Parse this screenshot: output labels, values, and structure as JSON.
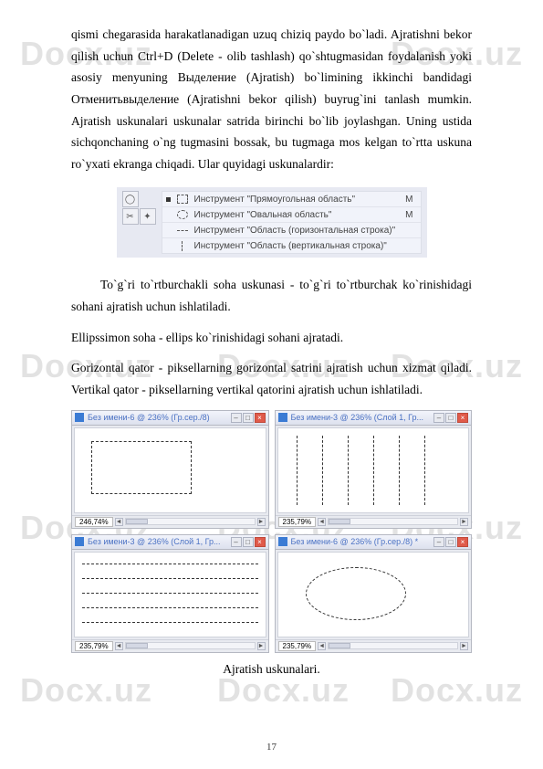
{
  "watermark": "Docx.uz",
  "para1": "qismi chegarasida harakatlanadigan uzuq chiziq paydo bo`ladi. Ajratishni bekor qilish uchun Ctrl+D (Delete - olib tashlash) qo`shtugmasidan foydalanish yoki asosiy menyuning Выделение (Ajratish) bo`limining ikkinchi bandidagi Отменитьвыделение (Ajratishni bekor qilish) buyrug`ini tanlash mumkin. Ajratish uskunalari uskunalar satrida birinchi bo`lib joylashgan. Uning ustida sichqonchaning o`ng tugmasini bossak, bu tugmaga mos kelgan to`rtta uskuna ro`yxati ekranga chiqadi. Ular quyidagi uskunalardir:",
  "toolbox": {
    "items": [
      {
        "label": "Инструмент \"Прямоугольная область\"",
        "key": "M"
      },
      {
        "label": "Инструмент \"Овальная область\"",
        "key": "M"
      },
      {
        "label": "Инструмент \"Область (горизонтальная строка)\"",
        "key": ""
      },
      {
        "label": "Инструмент \"Область (вертикальная строка)\"",
        "key": ""
      }
    ]
  },
  "para2": "To`g`ri to`rtburchakli soha uskunasi - to`g`ri to`rtburchak ko`rinishidagi sohani ajratish uchun ishlatiladi.",
  "para3": "Ellipssimon soha - ellips ko`rinishidagi sohani ajratadi.",
  "para4": "Gorizontal qator - piksellarning gorizontal satrini ajratish uchun xizmat qiladi. Vertikal qator - piksellarning vertikal qatorini ajratish uchun ishlatiladi.",
  "windows": {
    "w1": {
      "title": "Без имени-6 @ 236% (Гр.сер./8)",
      "zoom": "246,74%"
    },
    "w2": {
      "title": "Без имени-3 @ 236% (Слой 1, Гр...",
      "zoom": "235,79%"
    },
    "w3": {
      "title": "Без имени-3 @ 236% (Слой 1, Гр...",
      "zoom": "235,79%"
    },
    "w4": {
      "title": "Без имени-6 @ 236% (Гр.сер./8) *",
      "zoom": "235,79%"
    }
  },
  "caption": "Ajratish uskunalari.",
  "pagenum": "17"
}
